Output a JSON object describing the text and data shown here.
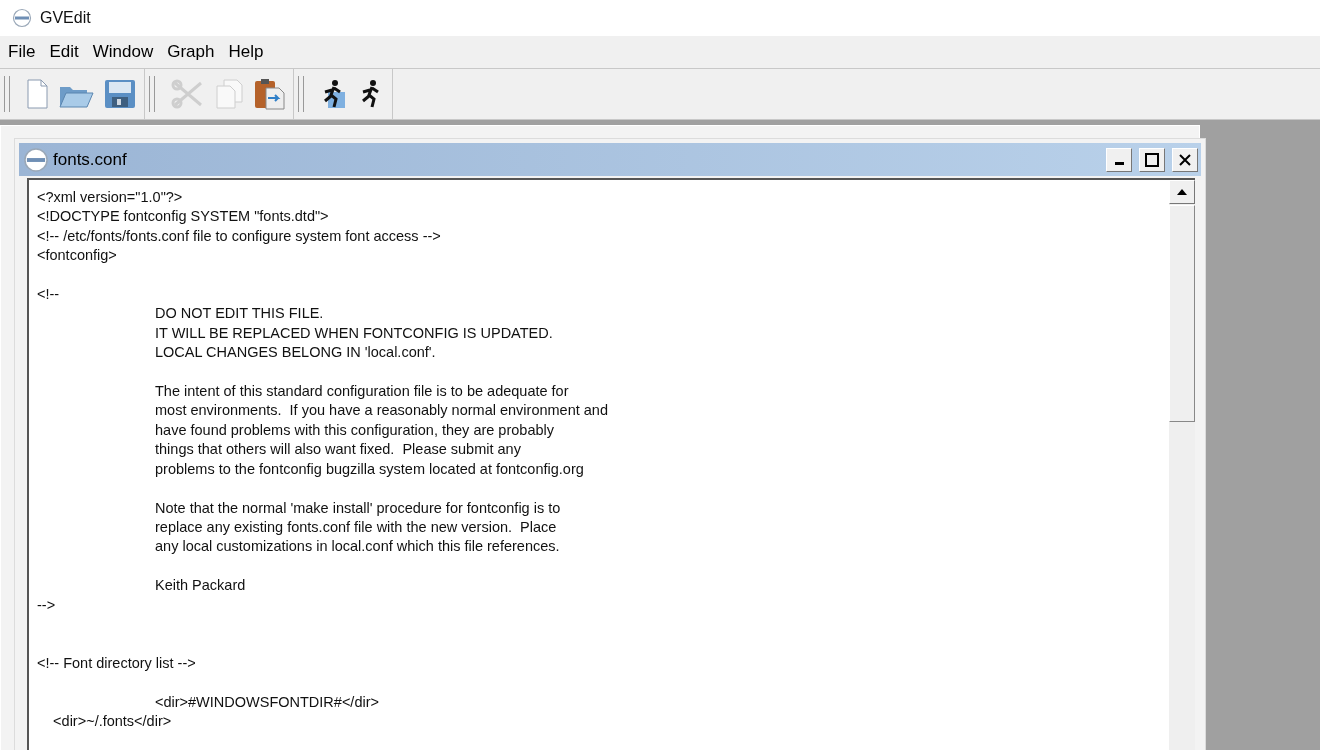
{
  "window": {
    "title": "GVEdit"
  },
  "menu_bar": [
    "File",
    "Edit",
    "Window",
    "Graph",
    "Help"
  ],
  "toolbar": [
    [
      {
        "kind": "new",
        "disabled": false
      },
      {
        "kind": "open",
        "disabled": false
      },
      {
        "kind": "save",
        "disabled": false
      }
    ],
    [
      {
        "kind": "cut",
        "disabled": true
      },
      {
        "kind": "copy",
        "disabled": true
      },
      {
        "kind": "paste",
        "disabled": false
      }
    ],
    [
      {
        "kind": "layout",
        "disabled": false
      },
      {
        "kind": "run",
        "disabled": false
      }
    ]
  ],
  "document": {
    "title": "fonts.conf",
    "text": "<?xml version=\"1.0\"?>\n<!DOCTYPE fontconfig SYSTEM \"fonts.dtd\">\n<!-- /etc/fonts/fonts.conf file to configure system font access -->\n<fontconfig>\n\n<!--\n\t\tDO NOT EDIT THIS FILE.\n\t\tIT WILL BE REPLACED WHEN FONTCONFIG IS UPDATED.\n\t\tLOCAL CHANGES BELONG IN 'local.conf'.\n\n\t\tThe intent of this standard configuration file is to be adequate for\n\t\tmost environments.  If you have a reasonably normal environment and\n\t\thave found problems with this configuration, they are probably\n\t\tthings that others will also want fixed.  Please submit any\n\t\tproblems to the fontconfig bugzilla system located at fontconfig.org\n\n\t\tNote that the normal 'make install' procedure for fontconfig is to\n\t\treplace any existing fonts.conf file with the new version.  Place\n\t\tany local customizations in local.conf which this file references.\n\n\t\tKeith Packard\n-->\n\n\n<!-- Font directory list -->\n\n\t\t<dir>#WINDOWSFONTDIR#</dir>\n    <dir>~/.fonts</dir>"
  }
}
